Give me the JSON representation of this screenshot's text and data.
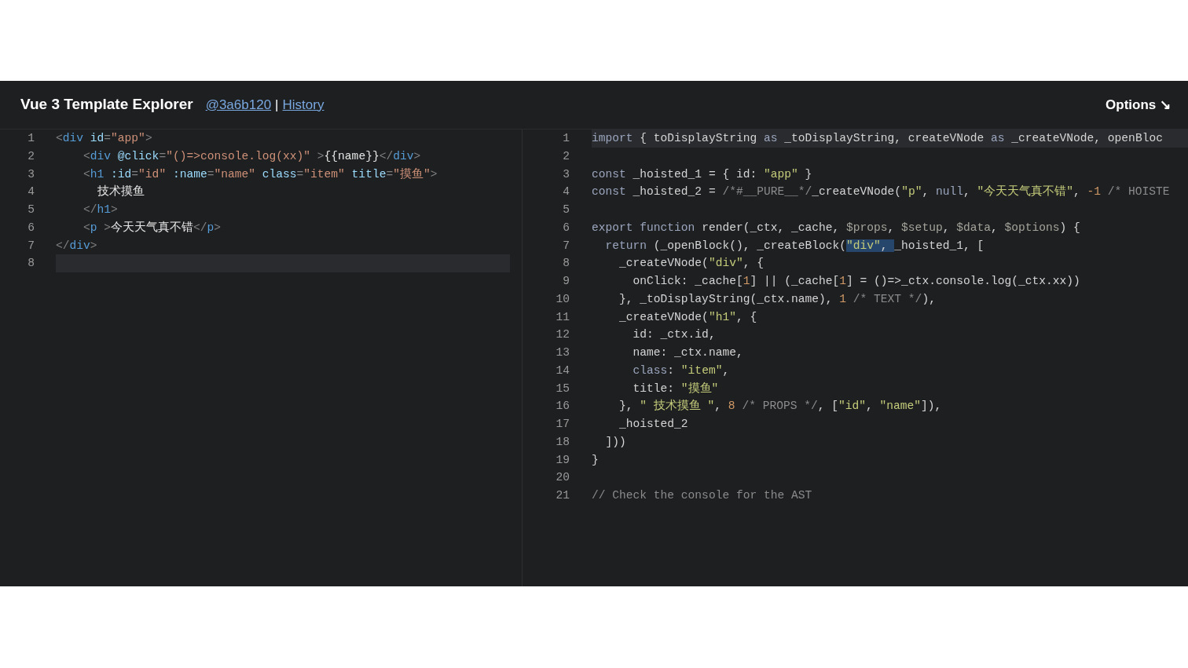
{
  "header": {
    "title": "Vue 3 Template Explorer",
    "commit_link": "@3a6b120",
    "separator": "|",
    "history_link": "History",
    "options_button": "Options ↘"
  },
  "source_editor": {
    "lines": [
      {
        "number": "1",
        "active": false,
        "tokens": [
          {
            "kind": "bracket",
            "text": "<"
          },
          {
            "kind": "tag",
            "text": "div"
          },
          {
            "kind": "attr",
            "text": " id"
          },
          {
            "kind": "bracket",
            "text": "="
          },
          {
            "kind": "string",
            "text": "\"app\""
          },
          {
            "kind": "bracket",
            "text": ">"
          }
        ]
      },
      {
        "number": "2",
        "active": false,
        "tokens": [
          {
            "kind": "bracket",
            "text": "    <"
          },
          {
            "kind": "tag",
            "text": "div"
          },
          {
            "kind": "attr",
            "text": " @click"
          },
          {
            "kind": "bracket",
            "text": "="
          },
          {
            "kind": "string",
            "text": "\"()=>console.log(xx)\""
          },
          {
            "kind": "bracket",
            "text": " >"
          },
          {
            "kind": "text",
            "text": "{{name}}"
          },
          {
            "kind": "bracket",
            "text": "</"
          },
          {
            "kind": "tag",
            "text": "div"
          },
          {
            "kind": "bracket",
            "text": ">"
          }
        ]
      },
      {
        "number": "3",
        "active": false,
        "tokens": [
          {
            "kind": "bracket",
            "text": "    <"
          },
          {
            "kind": "tag",
            "text": "h1"
          },
          {
            "kind": "attr",
            "text": " :id"
          },
          {
            "kind": "bracket",
            "text": "="
          },
          {
            "kind": "string",
            "text": "\"id\""
          },
          {
            "kind": "attr",
            "text": " :name"
          },
          {
            "kind": "bracket",
            "text": "="
          },
          {
            "kind": "string",
            "text": "\"name\""
          },
          {
            "kind": "attr",
            "text": " class"
          },
          {
            "kind": "bracket",
            "text": "="
          },
          {
            "kind": "string",
            "text": "\"item\""
          },
          {
            "kind": "attr",
            "text": " title"
          },
          {
            "kind": "bracket",
            "text": "="
          },
          {
            "kind": "string",
            "text": "\"摸鱼\""
          },
          {
            "kind": "bracket",
            "text": ">"
          }
        ]
      },
      {
        "number": "4",
        "active": false,
        "tokens": [
          {
            "kind": "text",
            "text": "      技术摸鱼"
          }
        ]
      },
      {
        "number": "5",
        "active": false,
        "tokens": [
          {
            "kind": "bracket",
            "text": "    </"
          },
          {
            "kind": "tag",
            "text": "h1"
          },
          {
            "kind": "bracket",
            "text": ">"
          }
        ]
      },
      {
        "number": "6",
        "active": false,
        "tokens": [
          {
            "kind": "bracket",
            "text": "    <"
          },
          {
            "kind": "tag",
            "text": "p"
          },
          {
            "kind": "bracket",
            "text": " >"
          },
          {
            "kind": "text",
            "text": "今天天气真不错"
          },
          {
            "kind": "bracket",
            "text": "</"
          },
          {
            "kind": "tag",
            "text": "p"
          },
          {
            "kind": "bracket",
            "text": ">"
          }
        ]
      },
      {
        "number": "7",
        "active": false,
        "tokens": [
          {
            "kind": "bracket",
            "text": "</"
          },
          {
            "kind": "tag",
            "text": "div"
          },
          {
            "kind": "bracket",
            "text": ">"
          }
        ]
      },
      {
        "number": "8",
        "active": true
      }
    ]
  },
  "output_editor": {
    "lines": [
      {
        "number": "1",
        "active": true,
        "tokens": [
          {
            "kind": "keyword",
            "text": "import"
          },
          {
            "kind": "plain",
            "text": " { toDisplayString "
          },
          {
            "kind": "keyword",
            "text": "as"
          },
          {
            "kind": "plain",
            "text": " _toDisplayString, createVNode "
          },
          {
            "kind": "keyword",
            "text": "as"
          },
          {
            "kind": "plain",
            "text": " _createVNode, openBloc"
          }
        ]
      },
      {
        "number": "2",
        "active": false
      },
      {
        "number": "3",
        "active": false,
        "tokens": [
          {
            "kind": "keyword",
            "text": "const"
          },
          {
            "kind": "plain",
            "text": " _hoisted_1 = { id: "
          },
          {
            "kind": "jsstring",
            "text": "\"app\""
          },
          {
            "kind": "plain",
            "text": " }"
          }
        ]
      },
      {
        "number": "4",
        "active": false,
        "tokens": [
          {
            "kind": "keyword",
            "text": "const"
          },
          {
            "kind": "plain",
            "text": " _hoisted_2 = "
          },
          {
            "kind": "comment",
            "text": "/*#__PURE__*/"
          },
          {
            "kind": "plain",
            "text": "_createVNode("
          },
          {
            "kind": "jsstring",
            "text": "\"p\""
          },
          {
            "kind": "plain",
            "text": ", "
          },
          {
            "kind": "keyword",
            "text": "null"
          },
          {
            "kind": "plain",
            "text": ", "
          },
          {
            "kind": "jsstring",
            "text": "\"今天天气真不错\""
          },
          {
            "kind": "plain",
            "text": ", "
          },
          {
            "kind": "number",
            "text": "-1"
          },
          {
            "kind": "comment",
            "text": " /* HOISTE"
          }
        ]
      },
      {
        "number": "5",
        "active": false
      },
      {
        "number": "6",
        "active": false,
        "tokens": [
          {
            "kind": "keyword",
            "text": "export"
          },
          {
            "kind": "keyword",
            "text": " function"
          },
          {
            "kind": "plain",
            "text": " render(_ctx, _cache, "
          },
          {
            "kind": "var",
            "text": "$props"
          },
          {
            "kind": "plain",
            "text": ", "
          },
          {
            "kind": "var",
            "text": "$setup"
          },
          {
            "kind": "plain",
            "text": ", "
          },
          {
            "kind": "var",
            "text": "$data"
          },
          {
            "kind": "plain",
            "text": ", "
          },
          {
            "kind": "var",
            "text": "$options"
          },
          {
            "kind": "plain",
            "text": ") {"
          }
        ]
      },
      {
        "number": "7",
        "active": false,
        "tokens": [
          {
            "kind": "keyword",
            "text": "  return"
          },
          {
            "kind": "plain",
            "text": " (_openBlock(), _createBlock("
          },
          {
            "kind": "jsstring",
            "text": "\"div\"",
            "selected": true
          },
          {
            "kind": "plain",
            "text": ", ",
            "selected": true
          },
          {
            "kind": "plain",
            "text": "_hoisted_1, ["
          }
        ]
      },
      {
        "number": "8",
        "active": false,
        "tokens": [
          {
            "kind": "plain",
            "text": "    _createVNode("
          },
          {
            "kind": "jsstring",
            "text": "\"div\""
          },
          {
            "kind": "plain",
            "text": ", {"
          }
        ]
      },
      {
        "number": "9",
        "active": false,
        "tokens": [
          {
            "kind": "plain",
            "text": "      onClick: _cache["
          },
          {
            "kind": "number",
            "text": "1"
          },
          {
            "kind": "plain",
            "text": "] || (_cache["
          },
          {
            "kind": "number",
            "text": "1"
          },
          {
            "kind": "plain",
            "text": "] = ()=>_ctx.console.log(_ctx.xx))"
          }
        ]
      },
      {
        "number": "10",
        "active": false,
        "tokens": [
          {
            "kind": "plain",
            "text": "    }, _toDisplayString(_ctx.name), "
          },
          {
            "kind": "number",
            "text": "1"
          },
          {
            "kind": "comment",
            "text": " /* TEXT */"
          },
          {
            "kind": "plain",
            "text": "),"
          }
        ]
      },
      {
        "number": "11",
        "active": false,
        "tokens": [
          {
            "kind": "plain",
            "text": "    _createVNode("
          },
          {
            "kind": "jsstring",
            "text": "\"h1\""
          },
          {
            "kind": "plain",
            "text": ", {"
          }
        ]
      },
      {
        "number": "12",
        "active": false,
        "tokens": [
          {
            "kind": "plain",
            "text": "      id: _ctx.id,"
          }
        ]
      },
      {
        "number": "13",
        "active": false,
        "tokens": [
          {
            "kind": "plain",
            "text": "      name: _ctx.name,"
          }
        ]
      },
      {
        "number": "14",
        "active": false,
        "tokens": [
          {
            "kind": "keyword",
            "text": "      class"
          },
          {
            "kind": "plain",
            "text": ": "
          },
          {
            "kind": "jsstring",
            "text": "\"item\""
          },
          {
            "kind": "plain",
            "text": ","
          }
        ]
      },
      {
        "number": "15",
        "active": false,
        "tokens": [
          {
            "kind": "plain",
            "text": "      title: "
          },
          {
            "kind": "jsstring",
            "text": "\"摸鱼\""
          }
        ]
      },
      {
        "number": "16",
        "active": false,
        "tokens": [
          {
            "kind": "plain",
            "text": "    }, "
          },
          {
            "kind": "jsstring",
            "text": "\" 技术摸鱼 \""
          },
          {
            "kind": "plain",
            "text": ", "
          },
          {
            "kind": "number",
            "text": "8"
          },
          {
            "kind": "comment",
            "text": " /* PROPS */"
          },
          {
            "kind": "plain",
            "text": ", ["
          },
          {
            "kind": "jsstring",
            "text": "\"id\""
          },
          {
            "kind": "plain",
            "text": ", "
          },
          {
            "kind": "jsstring",
            "text": "\"name\""
          },
          {
            "kind": "plain",
            "text": "]),"
          }
        ]
      },
      {
        "number": "17",
        "active": false,
        "tokens": [
          {
            "kind": "plain",
            "text": "    _hoisted_2"
          }
        ]
      },
      {
        "number": "18",
        "active": false,
        "tokens": [
          {
            "kind": "plain",
            "text": "  ]))"
          }
        ]
      },
      {
        "number": "19",
        "active": false,
        "tokens": [
          {
            "kind": "plain",
            "text": "}"
          }
        ]
      },
      {
        "number": "20",
        "active": false
      },
      {
        "number": "21",
        "active": false,
        "tokens": [
          {
            "kind": "comment",
            "text": "// Check the console for the AST"
          }
        ]
      }
    ]
  }
}
